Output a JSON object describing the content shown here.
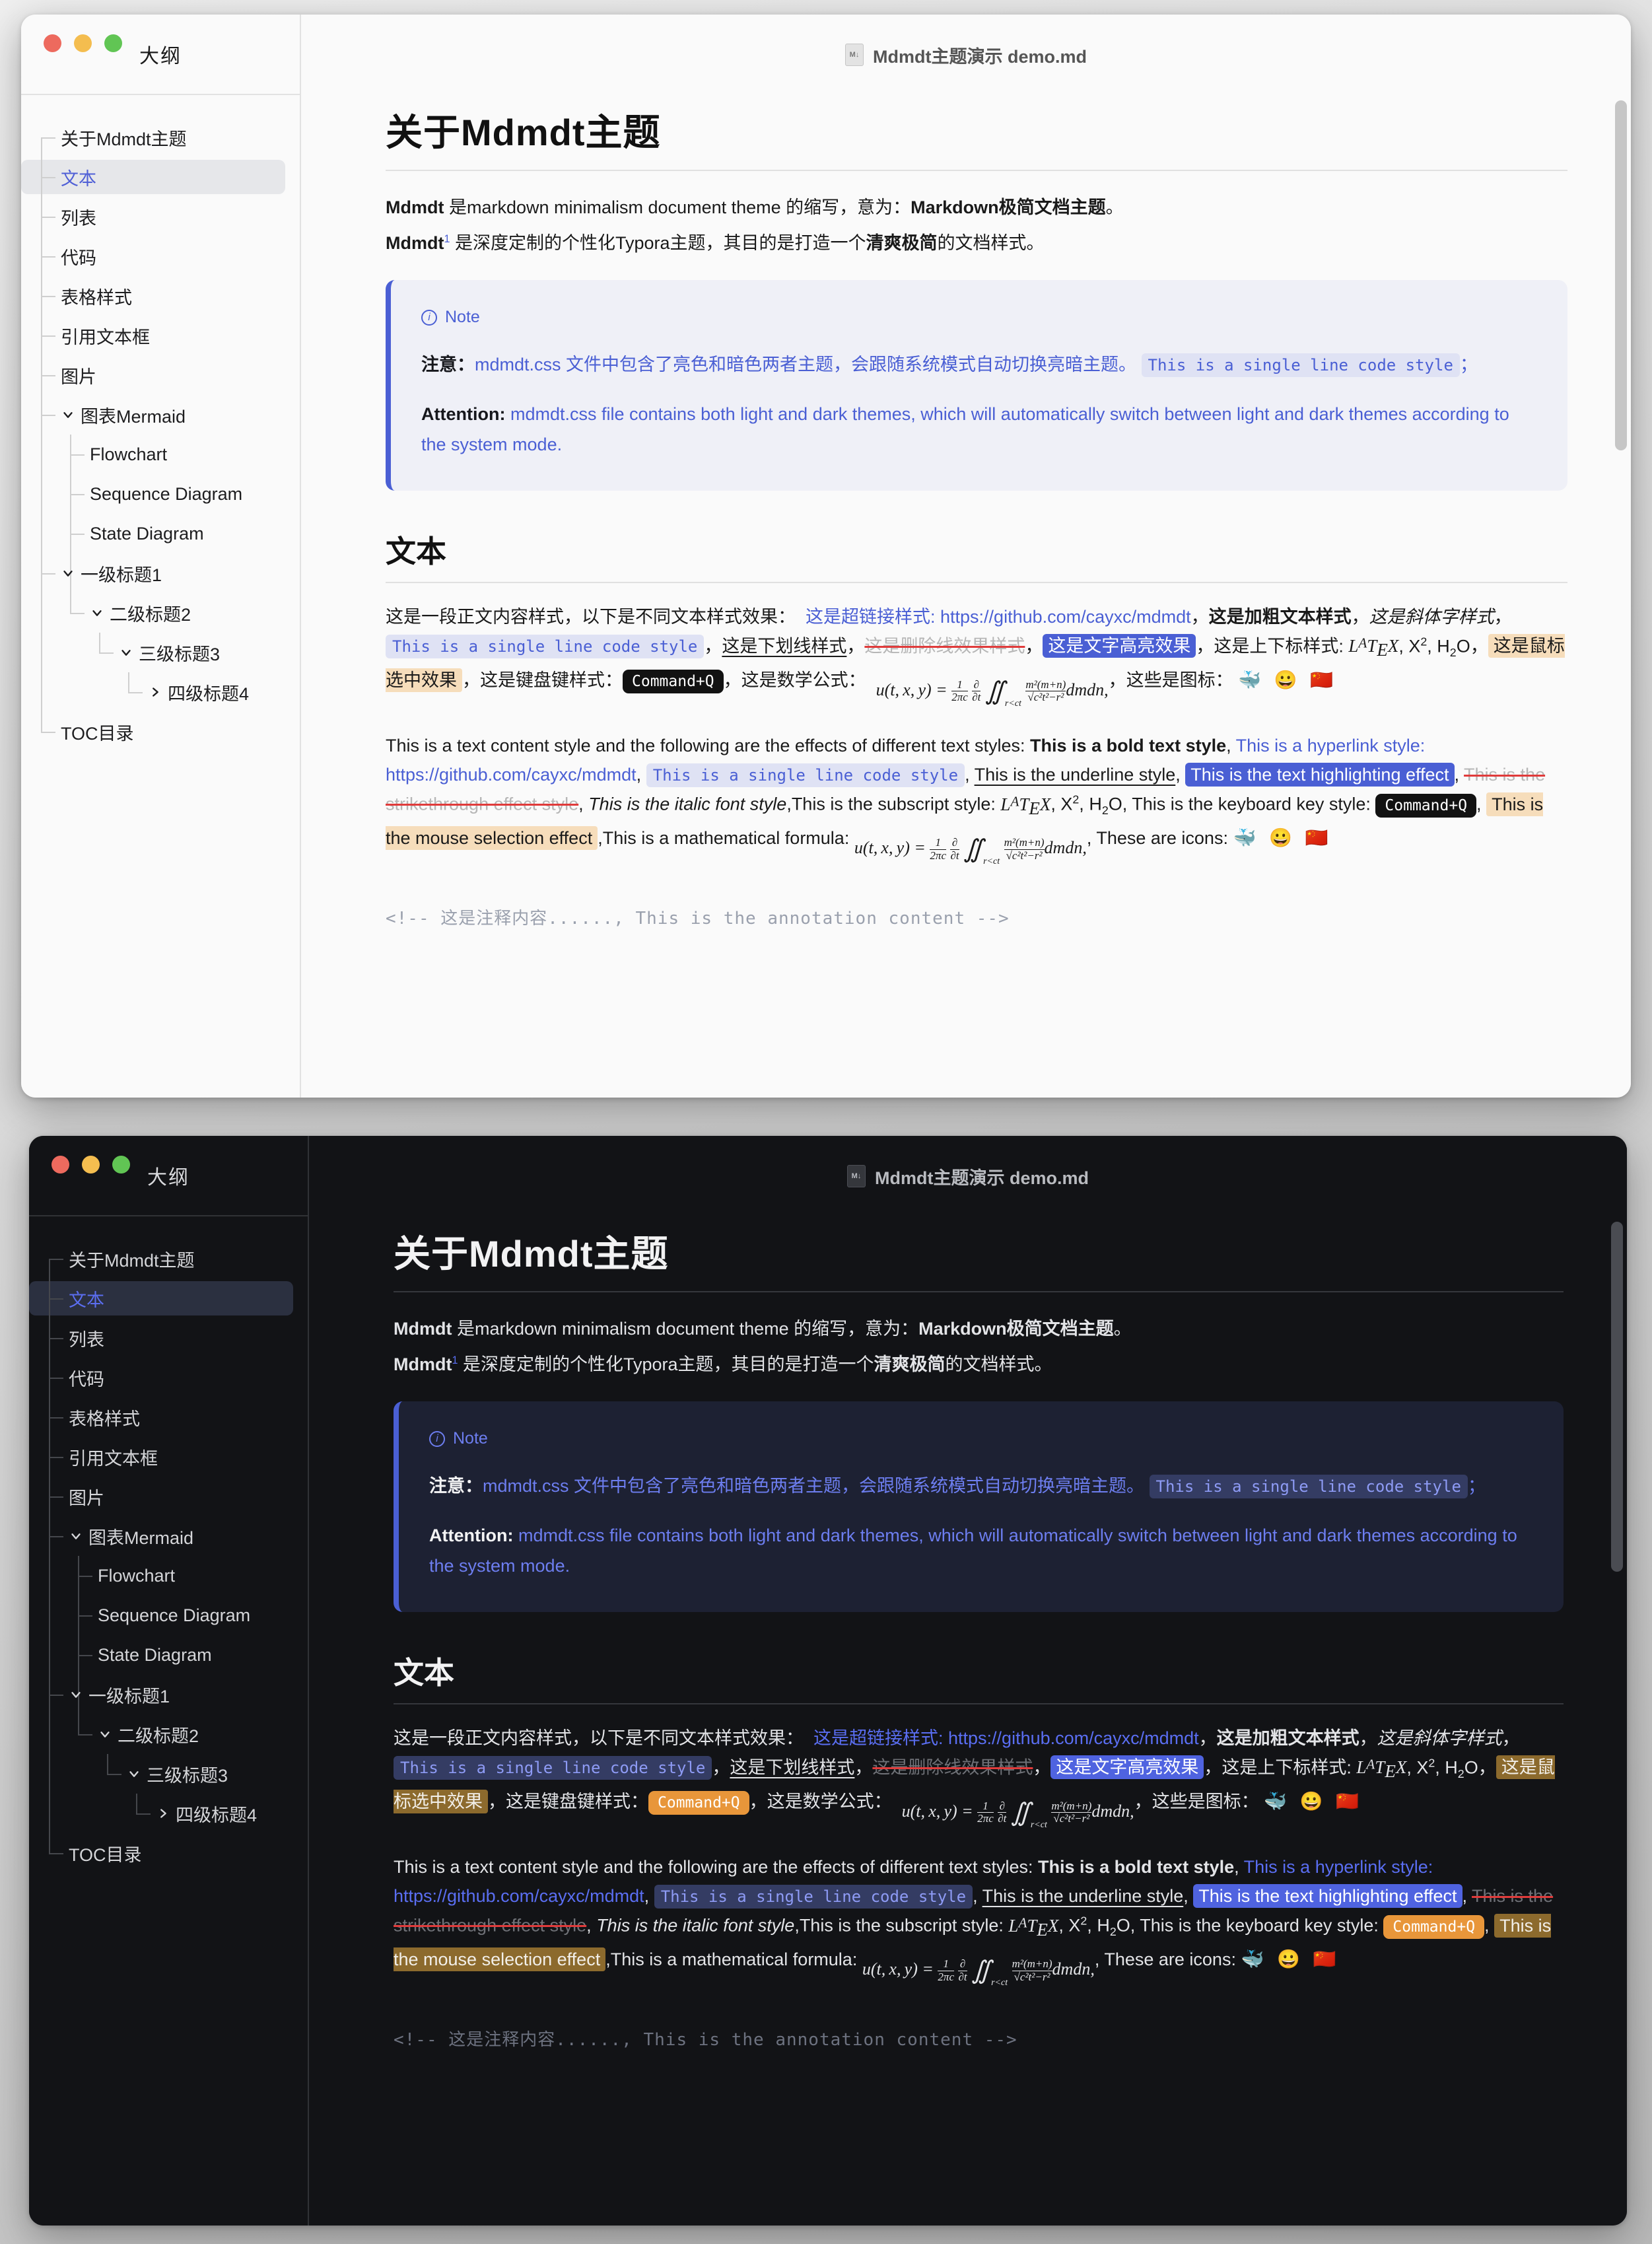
{
  "window_title": "Mdmdt主题演示 demo.md",
  "sidebar": {
    "header": "大纲",
    "items": [
      {
        "label": "关于Mdmdt主题",
        "level": 0,
        "caret": "none",
        "active": false
      },
      {
        "label": "文本",
        "level": 0,
        "caret": "none",
        "active": true
      },
      {
        "label": "列表",
        "level": 0,
        "caret": "none",
        "active": false
      },
      {
        "label": "代码",
        "level": 0,
        "caret": "none",
        "active": false
      },
      {
        "label": "表格样式",
        "level": 0,
        "caret": "none",
        "active": false
      },
      {
        "label": "引用文本框",
        "level": 0,
        "caret": "none",
        "active": false
      },
      {
        "label": "图片",
        "level": 0,
        "caret": "none",
        "active": false
      },
      {
        "label": "图表Mermaid",
        "level": 0,
        "caret": "down",
        "active": false
      },
      {
        "label": "Flowchart",
        "level": 1,
        "caret": "none",
        "active": false
      },
      {
        "label": "Sequence Diagram",
        "level": 1,
        "caret": "none",
        "active": false
      },
      {
        "label": "State Diagram",
        "level": 1,
        "caret": "none",
        "active": false
      },
      {
        "label": "一级标题1",
        "level": 0,
        "caret": "down",
        "active": false
      },
      {
        "label": "二级标题2",
        "level": 1,
        "caret": "down",
        "active": false
      },
      {
        "label": "三级标题3",
        "level": 2,
        "caret": "down",
        "active": false
      },
      {
        "label": "四级标题4",
        "level": 3,
        "caret": "right",
        "active": false
      },
      {
        "label": "TOC目录",
        "level": 0,
        "caret": "none",
        "active": false
      }
    ]
  },
  "document": {
    "h1": "关于Mdmdt主题",
    "intro": {
      "line1_a": "Mdmdt",
      "line1_b": " 是markdown minimalism document theme 的缩写，意为：",
      "line1_bold": "Markdown极简文档主题",
      "line1_c": "。",
      "line2_a": "Mdmdt",
      "line2_fn": "1",
      "line2_b": " 是深度定制的个性化Typora主题，其目的是打造一个",
      "line2_bold": "清爽极简",
      "line2_c": "的文档样式。"
    },
    "note": {
      "label": "Note",
      "cn_prefix": "注意：",
      "cn_text_a": "mdmdt.css 文件中包含了亮色和暗色两者主题，会跟随系统模式自动切换亮暗主题。 ",
      "cn_code": "This is a single line code style",
      "cn_text_b": "；",
      "en_prefix": "Attention:",
      "en_text": " mdmdt.css file contains both light and dark themes, which will automatically switch between light and dark themes according to the system mode."
    },
    "h2_text": "文本",
    "cn_styles": {
      "s01": "这是一段正文内容样式，以下是不同文本样式效果：",
      "link": "这是超链接样式: https://github.com/cayxc/mdmdt",
      "s02": "，",
      "bold": "这是加粗文本样式",
      "s03": "，",
      "italic": "这是斜体字样式",
      "s04": "，",
      "code": "This is a single line code style",
      "s05": "，",
      "underline": "这是下划线样式",
      "s06": "，",
      "strike": "这是删除线效果样式",
      "s07": "，",
      "highlight": "这是文字高亮效果",
      "s08": "，这是上下标样式: ",
      "sup_base": "X",
      "sup_val": "2",
      "sub_base": "H",
      "sub_val": "2",
      "sub_tail": "O",
      "s09": "，",
      "selection": "这是鼠标选中效果",
      "s10": "，这是键盘键样式：",
      "kbd": "Command+Q",
      "s11": "，这是数学公式：",
      "s12": "，这些是图标：",
      "emoji": "🐳 😀 🇨🇳"
    },
    "en_styles": {
      "s01": "This is a text content style and the following are the effects of different text styles:",
      "bold": "This is a bold text style",
      "s02": ",",
      "link": "This is a hyperlink style: https://github.com/cayxc/mdmdt",
      "s03": ",",
      "code": "This is a single line code style",
      "s04": ",",
      "underline": "This is the underline style",
      "s05": ",",
      "highlight": "This is the text highlighting effect",
      "s06": ",",
      "strike": "This is the strikethrough effect style",
      "s07": ",",
      "italic": "This is the italic font style",
      "s08": ",This is the subscript style: ",
      "sup_base": "X",
      "sup_val": "2",
      "sub_base": "H",
      "sub_val": "2",
      "sub_tail": "O",
      "s09": ",  This is the keyboard key style: ",
      "kbd": "Command+Q",
      "s10": ",",
      "selection": "This is the mouse selection effect",
      "s11": ",This is a mathematical formula: ",
      "s12": ",  These are icons: ",
      "emoji": "🐳 😀 🇨🇳"
    },
    "comment": "<!-- 这是注释内容......, This is the annotation content -->"
  },
  "colors": {
    "accent_blue": "#4a5fd4",
    "highlight_blue": "#4a5fd4",
    "selection_light": "#f6ddbb",
    "selection_dark": "#8c6a2d",
    "kbd_light": "#121212",
    "kbd_dark": "#e8963a",
    "strike_line": "#e03b3b",
    "traffic_red": "#ed6a5e",
    "traffic_yellow": "#f4bd4f",
    "traffic_green": "#61c554"
  }
}
